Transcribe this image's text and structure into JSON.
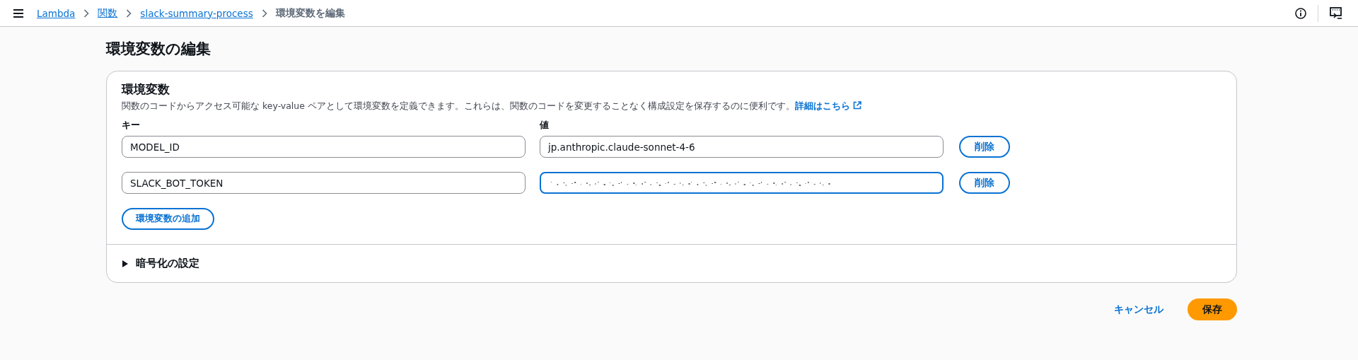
{
  "breadcrumbs": [
    {
      "label": "Lambda",
      "link": true
    },
    {
      "label": "関数",
      "link": true
    },
    {
      "label": "slack-summary-process",
      "link": true
    },
    {
      "label": "環境変数を編集",
      "link": false
    }
  ],
  "page_title": "環境変数の編集",
  "env_section": {
    "title": "環境変数",
    "description": "関数のコードからアクセス可能な key-value ペアとして環境変数を定義できます。これらは、関数のコードを変更することなく構成設定を保存するのに便利です。",
    "learn_more": "詳細はこちら",
    "key_label": "キー",
    "value_label": "値",
    "variables": [
      {
        "key": "MODEL_ID",
        "value": "jp.anthropic.claude-sonnet-4-6",
        "focused": false,
        "redacted": false,
        "remove": "削除"
      },
      {
        "key": "SLACK_BOT_TOKEN",
        "focused": true,
        "redacted": true,
        "remove": "削除"
      }
    ],
    "add_button": "環境変数の追加"
  },
  "encryption": {
    "label": "暗号化の設定",
    "expanded": false
  },
  "actions": {
    "cancel": "キャンセル",
    "save": "保存"
  }
}
